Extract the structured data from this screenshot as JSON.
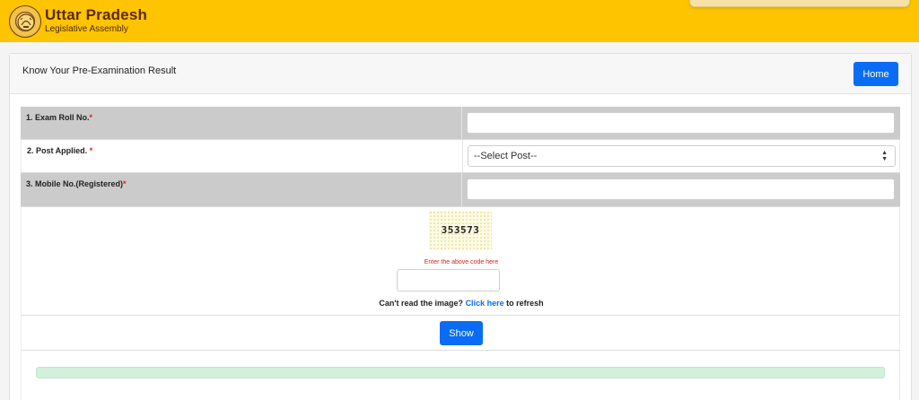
{
  "header": {
    "brand_title": "Uttar Pradesh",
    "brand_subtitle": "Legislative Assembly",
    "logo_icon": "emblem-icon",
    "background_color": "#ffc400"
  },
  "card": {
    "title": "Know Your Pre-Examination Result",
    "home_button": "Home"
  },
  "form": {
    "fields": [
      {
        "label": "1. Exam Roll No.",
        "required_mark": "*",
        "value": ""
      },
      {
        "label": "2. Post Applied. ",
        "required_mark": "*",
        "selected": "--Select Post--"
      },
      {
        "label": "3. Mobile No.(Registered)",
        "required_mark": "*",
        "value": ""
      }
    ]
  },
  "captcha": {
    "code": "353573",
    "hint": "Enter the above code here",
    "input_value": "",
    "refresh_prefix": "Can't read the image?",
    "refresh_link": "Click here",
    "refresh_suffix": "to refresh"
  },
  "actions": {
    "show_button": "Show"
  },
  "colors": {
    "accent": "#0a6cf5",
    "required": "#e02020",
    "result_bar": "#d2f0dc"
  }
}
